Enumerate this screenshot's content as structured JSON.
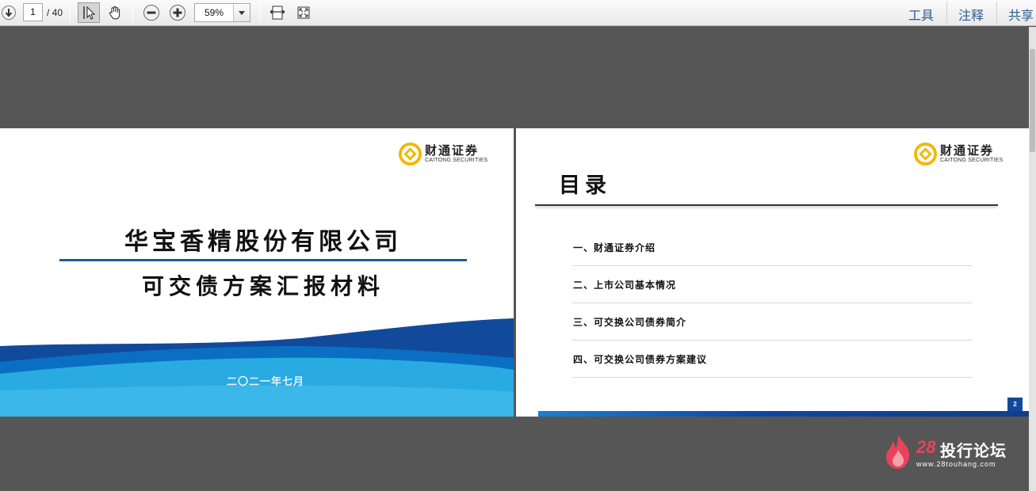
{
  "toolbar": {
    "page_current": "1",
    "page_total": "/ 40",
    "zoom": "59%",
    "menu": [
      "工具",
      "注释",
      "共享"
    ]
  },
  "slide1": {
    "logo_cn": "财通证券",
    "logo_en": "CAITONG SECURITIES",
    "title": "华宝香精股份有限公司",
    "subtitle": "可交债方案汇报材料",
    "date": "二〇二一年七月"
  },
  "slide2": {
    "logo_cn": "财通证券",
    "logo_en": "CAITONG SECURITIES",
    "heading": "目录",
    "items": [
      "一、财通证券介绍",
      "二、上市公司基本情况",
      "三、可交换公司债券简介",
      "四、可交换公司债券方案建议"
    ],
    "page_number": "2"
  },
  "watermark": {
    "brand_num": "28",
    "brand_text": "投行论坛",
    "url": "www.28touhang.com"
  },
  "colors": {
    "background": "#565656",
    "brand_blue": "#114a9a",
    "wave_light": "#29abe2",
    "logo_gold": "#f2b705",
    "link_blue": "#2b5d8f"
  }
}
